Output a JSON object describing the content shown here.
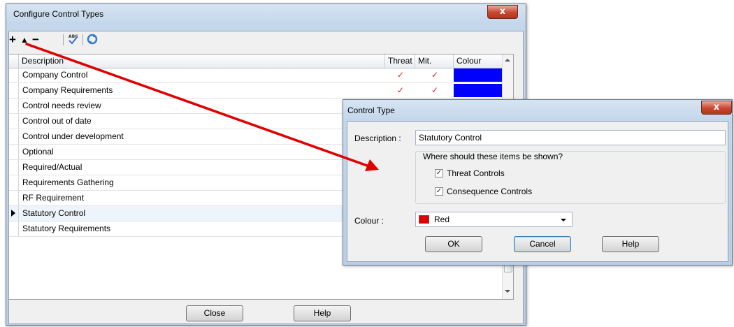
{
  "main_window": {
    "title": "Configure Control Types",
    "close_glyph": "x",
    "toolbar": {
      "add_glyph": "+",
      "move_up_glyph": "▲",
      "remove_glyph": "−",
      "icons": [
        "add-icon",
        "move-up-icon",
        "remove-icon",
        "spellcheck-icon",
        "refresh-icon"
      ]
    },
    "grid": {
      "columns": [
        "Description",
        "Threat",
        "Mit.",
        "Colour"
      ],
      "check_glyph": "✓",
      "rows": [
        {
          "description": "Company Control",
          "threat": true,
          "mit": true,
          "colour": "#0000ff"
        },
        {
          "description": "Company Requirements",
          "threat": true,
          "mit": true,
          "colour": "#0000ff"
        },
        {
          "description": "Control needs review",
          "threat": false,
          "mit": false,
          "colour": "#00e5ff"
        },
        {
          "description": "Control out of date",
          "threat": false,
          "mit": false,
          "colour": ""
        },
        {
          "description": "Control under development",
          "threat": false,
          "mit": false,
          "colour": ""
        },
        {
          "description": "Optional",
          "threat": false,
          "mit": false,
          "colour": ""
        },
        {
          "description": "Required/Actual",
          "threat": false,
          "mit": false,
          "colour": ""
        },
        {
          "description": "Requirements Gathering",
          "threat": false,
          "mit": false,
          "colour": ""
        },
        {
          "description": "RF Requirement",
          "threat": false,
          "mit": false,
          "colour": ""
        },
        {
          "description": "Statutory Control",
          "threat": false,
          "mit": false,
          "colour": "",
          "selected": true
        },
        {
          "description": "Statutory Requirements",
          "threat": false,
          "mit": false,
          "colour": ""
        }
      ]
    },
    "close_label": "Close",
    "help_label": "Help"
  },
  "dialog": {
    "title": "Control Type",
    "close_glyph": "x",
    "description_label": "Description :",
    "description_value": "Statutory Control",
    "group_label": "Where should these items be shown?",
    "checkbox_glyph": "✓",
    "threat_controls_label": "Threat Controls",
    "threat_controls_checked": true,
    "consequence_controls_label": "Consequence Controls",
    "consequence_controls_checked": true,
    "colour_label": "Colour :",
    "colour_value": "Red",
    "colour_swatch": "#e00000",
    "ok_label": "OK",
    "cancel_label": "Cancel",
    "help_label": "Help"
  },
  "annotation": {
    "arrow_color": "#e00000"
  }
}
